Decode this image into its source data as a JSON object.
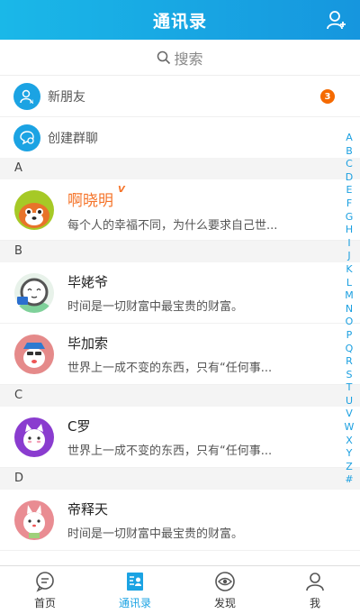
{
  "header": {
    "title": "通讯录"
  },
  "search": {
    "placeholder": "搜索"
  },
  "entries": [
    {
      "label": "新朋友",
      "badge": "3"
    },
    {
      "label": "创建群聊"
    }
  ],
  "sections": {
    "a": "A",
    "b": "B",
    "c": "C",
    "d": "D"
  },
  "contacts": [
    {
      "name": "啊晓明",
      "vip": "V",
      "signature": "每个人的幸福不同，为什么要求自己世..."
    },
    {
      "name": "毕姥爷",
      "signature": "时间是一切财富中最宝贵的财富。"
    },
    {
      "name": "毕加索",
      "signature": "世界上一成不变的东西，只有“任何事..."
    },
    {
      "name": "C罗",
      "signature": "世界上一成不变的东西，只有“任何事..."
    },
    {
      "name": "帝释天",
      "signature": "时间是一切财富中最宝贵的财富。"
    }
  ],
  "index_letters": [
    "A",
    "B",
    "C",
    "D",
    "E",
    "F",
    "G",
    "H",
    "I",
    "J",
    "K",
    "L",
    "M",
    "N",
    "O",
    "P",
    "Q",
    "R",
    "S",
    "T",
    "U",
    "V",
    "W",
    "X",
    "Y",
    "Z",
    "#"
  ],
  "tabs": [
    {
      "label": "首页",
      "icon": "chat-bubble-icon"
    },
    {
      "label": "通讯录",
      "icon": "contacts-icon"
    },
    {
      "label": "发现",
      "icon": "eye-icon"
    },
    {
      "label": "我",
      "icon": "person-icon"
    }
  ],
  "colors": {
    "brand": "#1ba3e3",
    "badge": "#f56a00",
    "vip": "#f5742a"
  }
}
